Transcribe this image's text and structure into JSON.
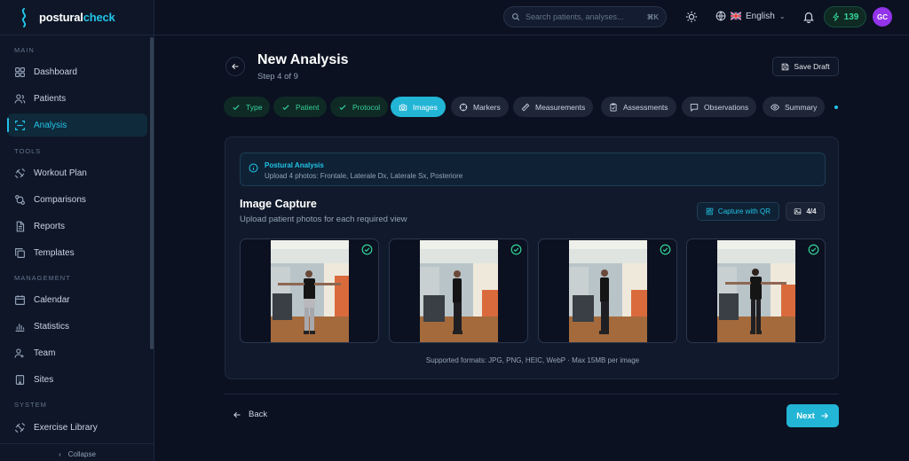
{
  "brand": {
    "name_part1": "postural",
    "name_part2": "check"
  },
  "sidebar": {
    "sections": [
      "MAIN",
      "TOOLS",
      "MANAGEMENT",
      "SYSTEM"
    ],
    "items": [
      {
        "label": "Dashboard",
        "icon": "grid-icon"
      },
      {
        "label": "Patients",
        "icon": "users-icon"
      },
      {
        "label": "Analysis",
        "icon": "scan-icon",
        "active": true
      },
      {
        "label": "Workout Plan",
        "icon": "dumbbell-icon"
      },
      {
        "label": "Comparisons",
        "icon": "compare-icon"
      },
      {
        "label": "Reports",
        "icon": "file-icon"
      },
      {
        "label": "Templates",
        "icon": "copy-icon"
      },
      {
        "label": "Calendar",
        "icon": "calendar-icon"
      },
      {
        "label": "Statistics",
        "icon": "bar-chart-icon"
      },
      {
        "label": "Team",
        "icon": "team-icon"
      },
      {
        "label": "Sites",
        "icon": "building-icon"
      },
      {
        "label": "Exercise Library",
        "icon": "dumbbell-icon"
      }
    ],
    "collapse_label": "Collapse"
  },
  "header": {
    "search_placeholder": "Search patients, analyses...",
    "search_shortcut": "⌘K",
    "language": "English",
    "credits": "139",
    "avatar_initials": "GC"
  },
  "page": {
    "title": "New Analysis",
    "step": "Step 4 of 9",
    "save_draft": "Save Draft"
  },
  "steps": [
    {
      "label": "Type",
      "state": "done"
    },
    {
      "label": "Patient",
      "state": "done"
    },
    {
      "label": "Protocol",
      "state": "done"
    },
    {
      "label": "Images",
      "state": "current"
    },
    {
      "label": "Markers",
      "state": "todo"
    },
    {
      "label": "Measurements",
      "state": "todo"
    },
    {
      "label": "Assessments",
      "state": "todo"
    },
    {
      "label": "Observations",
      "state": "todo"
    },
    {
      "label": "Summary",
      "state": "todo"
    }
  ],
  "info": {
    "title": "Postural Analysis",
    "text": "Upload 4 photos: Frontale, Laterale Dx, Laterale Sx, Posteriore"
  },
  "capture": {
    "title": "Image Capture",
    "subtitle": "Upload patient photos for each required view",
    "qr_button": "Capture with QR",
    "count": "4/4",
    "formats": "Supported formats: JPG, PNG, HEIC, WebP · Max 15MB per image"
  },
  "footer": {
    "back": "Back",
    "next": "Next"
  },
  "colors": {
    "accent": "#22b5d6",
    "success": "#34d399",
    "background": "#0b1120"
  }
}
